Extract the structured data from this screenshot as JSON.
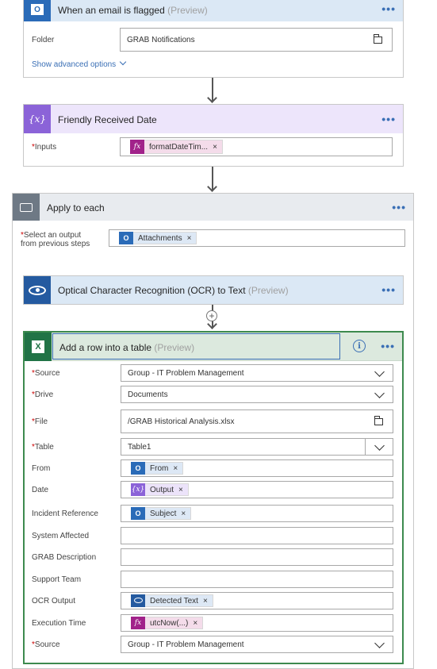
{
  "email_card": {
    "title": "When an email is flagged",
    "preview": "(Preview)",
    "folder_label": "Folder",
    "folder_value": "GRAB Notifications",
    "advanced_link": "Show advanced options"
  },
  "friendly_card": {
    "title": "Friendly Received Date",
    "inputs_label": "Inputs",
    "token": "formatDateTim..."
  },
  "apply_card": {
    "title": "Apply to each",
    "select_label_1": "Select an output",
    "select_label_2": "from previous steps",
    "token": "Attachments"
  },
  "ocr_card": {
    "title": "Optical Character Recognition (OCR) to Text",
    "preview": "(Preview)"
  },
  "excel_card": {
    "title": "Add a row into a table",
    "preview": "(Preview)",
    "rows": [
      {
        "label": "Source",
        "required": "*",
        "value": "Group - IT Problem Management"
      },
      {
        "label": "Drive",
        "required": "*",
        "value": "Documents"
      },
      {
        "label": "File",
        "required": "*",
        "value": "/GRAB Historical Analysis.xlsx"
      },
      {
        "label": "Table",
        "required": "*",
        "value": "Table1"
      },
      {
        "label": "From",
        "token": "From"
      },
      {
        "label": "Date",
        "token": "Output"
      },
      {
        "label": "Incident Reference",
        "token": "Subject"
      },
      {
        "label": "System Affected"
      },
      {
        "label": "GRAB Description"
      },
      {
        "label": "Support Team"
      },
      {
        "label": "OCR Output",
        "token": "Detected Text"
      },
      {
        "label": "Execution Time",
        "token": "utcNow(...)"
      },
      {
        "label": "Source",
        "required": "*",
        "value": "Group - IT Problem Management"
      }
    ]
  },
  "common": {
    "required_mark": "*",
    "more": "•••",
    "remove": "×",
    "fx": "fx",
    "var_icon": "{x}",
    "outlook_icon": "O",
    "excel_icon": "X",
    "info_icon": "i"
  },
  "colors": {
    "outlook_header": "#dbe8f5",
    "variable_header": "#ede5fb",
    "apply_header": "#e8ebef",
    "excel_header": "#dce9de",
    "excel_border": "#3d8a4e",
    "accent": "#3a6fb5"
  }
}
